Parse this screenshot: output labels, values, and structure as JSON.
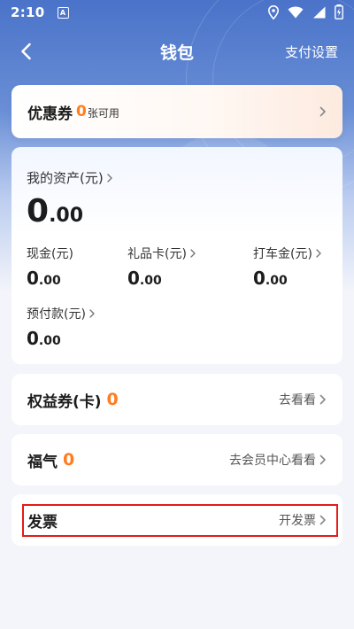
{
  "status": {
    "time": "2:10",
    "a_badge": "A"
  },
  "nav": {
    "title": "钱包",
    "right": "支付设置"
  },
  "coupon": {
    "title": "优惠券",
    "count": "0",
    "unit": "张可用"
  },
  "assets": {
    "label": "我的资产(元)",
    "total_int": "0",
    "total_dec": ".00",
    "items": [
      {
        "label": "现金(元)",
        "int": "0",
        "dec": ".00"
      },
      {
        "label": "礼品卡(元)",
        "int": "0",
        "dec": ".00"
      },
      {
        "label": "打车金(元)",
        "int": "0",
        "dec": ".00"
      },
      {
        "label": "预付款(元)",
        "int": "0",
        "dec": ".00"
      }
    ]
  },
  "rights": {
    "title": "权益券(卡)",
    "count": "0",
    "action": "去看看"
  },
  "fortune": {
    "title": "福气",
    "count": "0",
    "action": "去会员中心看看"
  },
  "invoice": {
    "title": "发票",
    "action": "开发票"
  },
  "colors": {
    "accent": "#ff7d1f",
    "highlight": "#e31b1b",
    "header": "#4a73c9"
  },
  "icons": [
    "wifi-icon",
    "location-icon",
    "signal-icon",
    "battery-icon",
    "back-arrow-icon",
    "chevron-right-icon"
  ]
}
